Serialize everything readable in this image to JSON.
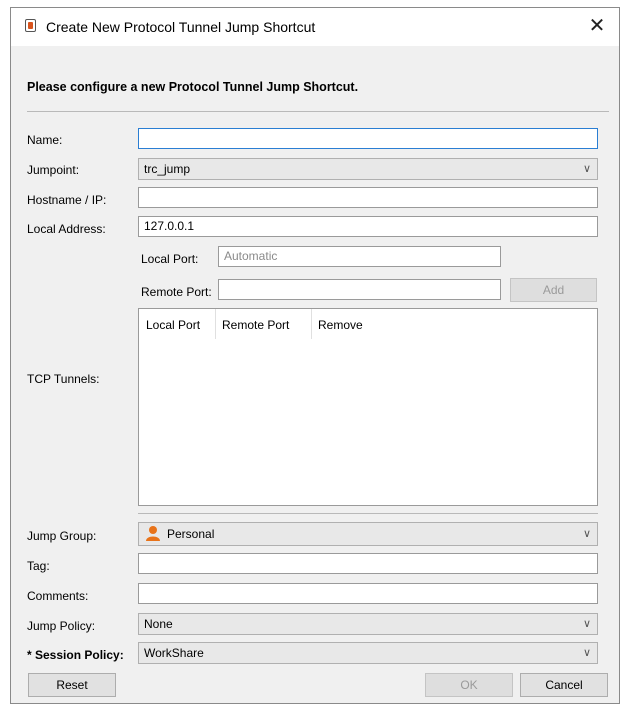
{
  "window": {
    "title": "Create New Protocol Tunnel Jump Shortcut",
    "close_glyph": "✕"
  },
  "heading": "Please configure a new Protocol Tunnel Jump Shortcut.",
  "fields": {
    "name": {
      "label": "Name:",
      "value": ""
    },
    "jumpoint": {
      "label": "Jumpoint:",
      "value": "trc_jump"
    },
    "hostname": {
      "label": "Hostname / IP:",
      "value": ""
    },
    "local_address": {
      "label": "Local Address:",
      "value": "127.0.0.1"
    },
    "local_port": {
      "label": "Local Port:",
      "value": "",
      "placeholder": "Automatic"
    },
    "remote_port": {
      "label": "Remote Port:",
      "value": ""
    },
    "add_button": "Add",
    "tcp_tunnels": {
      "label": "TCP Tunnels:",
      "columns": [
        "Local Port",
        "Remote Port",
        "Remove"
      ],
      "rows": []
    },
    "jump_group": {
      "label": "Jump Group:",
      "value": "Personal",
      "icon": "person-icon"
    },
    "tag": {
      "label": "Tag:",
      "value": ""
    },
    "comments": {
      "label": "Comments:",
      "value": ""
    },
    "jump_policy": {
      "label": "Jump Policy:",
      "value": "None"
    },
    "session_policy": {
      "label": "* Session Policy:",
      "value": "WorkShare"
    }
  },
  "buttons": {
    "reset": "Reset",
    "ok": "OK",
    "cancel": "Cancel"
  },
  "colors": {
    "focus_border": "#2a7ed3",
    "person_icon": "#e8731a"
  }
}
